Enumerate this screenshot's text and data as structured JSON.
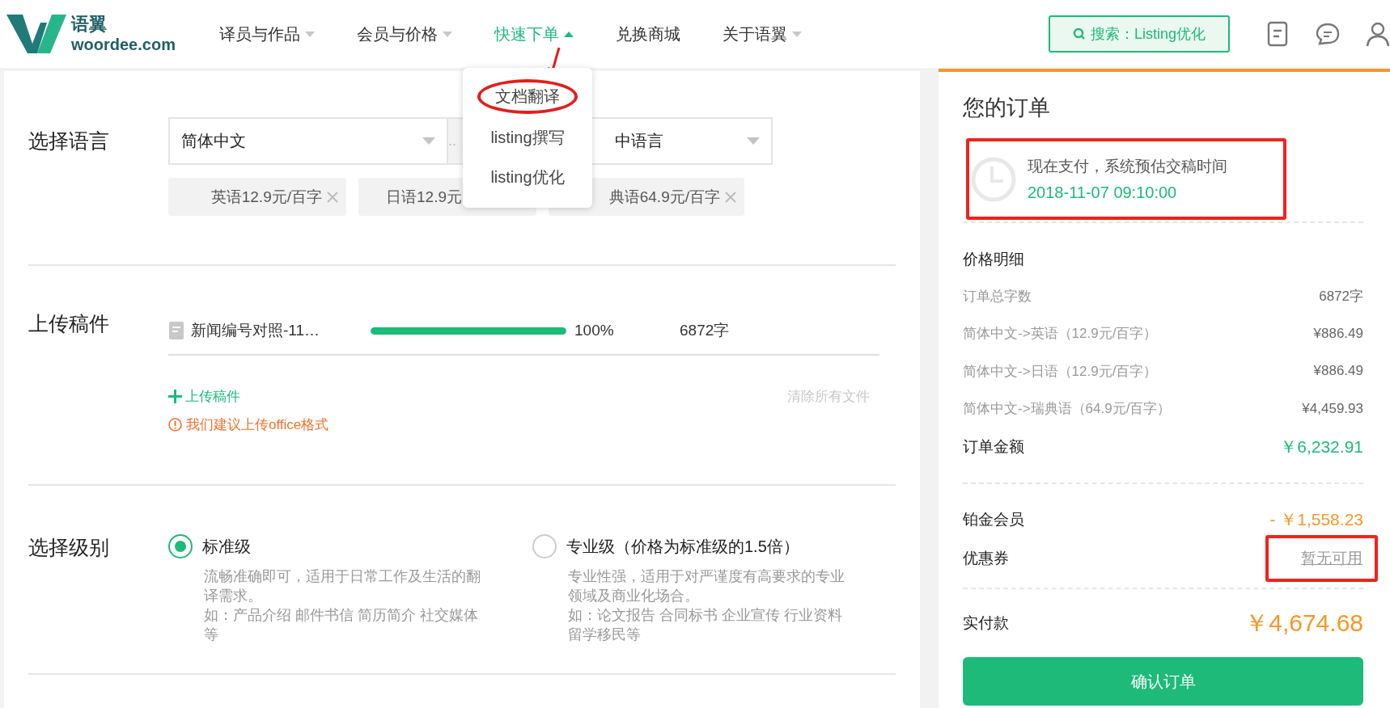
{
  "header": {
    "logo": {
      "mark_text": "语翼",
      "domain": "woordee.com"
    },
    "nav": [
      {
        "label": "译员与作品",
        "selected": false,
        "has_menu": true,
        "pointer": false
      },
      {
        "label": "会员与价格",
        "selected": false,
        "has_menu": true,
        "pointer": false
      },
      {
        "label": "快速下单",
        "selected": true,
        "has_menu": true,
        "pointer": true
      },
      {
        "label": "兑换商城",
        "selected": false,
        "has_menu": false,
        "pointer": false
      },
      {
        "label": "关于语翼",
        "selected": false,
        "has_menu": true,
        "pointer": false
      }
    ],
    "search_button": "搜索：Listing优化"
  },
  "dropdown": {
    "items": [
      {
        "label": "文档翻译",
        "highlighted": true
      },
      {
        "label": "listing撰写",
        "highlighted": false
      },
      {
        "label": "listing优化",
        "highlighted": false
      }
    ]
  },
  "language": {
    "title": "选择语言",
    "source": "简体中文",
    "separator": "..",
    "target": "中语言",
    "tags": [
      {
        "label": "英语12.9元/百字",
        "removable": true
      },
      {
        "label": "日语12.9元",
        "removable": false
      },
      {
        "label": "典语64.9元/百字",
        "removable": true
      }
    ]
  },
  "upload": {
    "title": "上传稿件",
    "file": {
      "name": "新闻编号对照-11…",
      "level": 1,
      "percent": "100%",
      "words": "6872字"
    },
    "add": "上传稿件",
    "clear": "清除所有文件",
    "note": "我们建议上传office格式"
  },
  "level": {
    "title": "选择级别",
    "options": [
      {
        "label": "标准级",
        "selected": true,
        "desc": [
          "流畅准确即可，适用于日常工作及生活的翻译需求。",
          "如：产品介绍 邮件书信 简历简介 社交媒体等"
        ]
      },
      {
        "label": "专业级（价格为标准级的1.5倍）",
        "selected": false,
        "desc": [
          "专业性强，适用于对严谨度有高要求的专业领域及商业化场合。",
          "如：论文报告 合同标书 企业宣传 行业资料留学移民等"
        ]
      }
    ]
  },
  "order": {
    "title": "您的订单",
    "eta": {
      "label": "现在支付，系统预估交稿时间",
      "time": "2018-11-07 09:10:00",
      "highlighted": true
    },
    "details_title": "价格明细",
    "rows": [
      {
        "label": "订单总字数",
        "value": "6872字"
      },
      {
        "label": "简体中文->英语（12.9元/百字）",
        "value": "¥886.49"
      },
      {
        "label": "简体中文->日语（12.9元/百字）",
        "value": "¥886.49"
      },
      {
        "label": "简体中文->瑞典语（64.9元/百字）",
        "value": "¥4,459.93"
      }
    ],
    "total": {
      "label": "订单金额",
      "value": "￥6,232.91"
    },
    "member": {
      "label": "铂金会员",
      "value": "- ￥1,558.23"
    },
    "coupon": {
      "label": "优惠券",
      "value": "暂无可用",
      "highlighted": true
    },
    "pay": {
      "label": "实付款",
      "value": "￥4,674.68"
    },
    "confirm": "确认订单"
  }
}
